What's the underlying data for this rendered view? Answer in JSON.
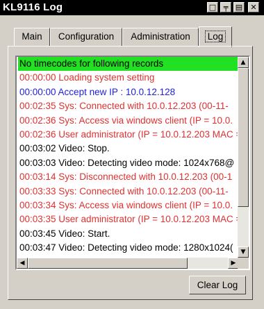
{
  "window": {
    "title": "KL9116 Log",
    "buttons": [
      {
        "name": "window-restore-button",
        "icon": "restore-icon",
        "glyph": "□"
      },
      {
        "name": "window-pin-button",
        "icon": "pin-icon",
        "glyph": "╤"
      },
      {
        "name": "window-export-button",
        "icon": "export-icon",
        "glyph": "▤"
      },
      {
        "name": "window-close-button",
        "icon": "close-icon",
        "glyph": "✕"
      }
    ]
  },
  "tabs": [
    {
      "label": "Main",
      "active": false
    },
    {
      "label": "Configuration",
      "active": false
    },
    {
      "label": "Administration",
      "active": false
    },
    {
      "label": "Log",
      "active": true
    }
  ],
  "log": {
    "header": "No timecodes for following records",
    "entries": [
      {
        "text": "00:00:00 Loading system setting",
        "color": "red"
      },
      {
        "text": "00:00:00 Accept new IP : 10.0.12.128",
        "color": "blue"
      },
      {
        "text": "00:02:35 Sys: Connected with 10.0.12.203 (00-11-",
        "color": "red"
      },
      {
        "text": "00:02:36 Sys: Access via windows client (IP = 10.0.",
        "color": "red"
      },
      {
        "text": "00:02:36 User administrator (IP = 10.0.12.203 MAC =",
        "color": "red"
      },
      {
        "text": "00:03:02 Video: Stop.",
        "color": "black"
      },
      {
        "text": "00:03:03 Video: Detecting video mode: 1024x768@",
        "color": "black"
      },
      {
        "text": "00:03:14 Sys: Disconnected with 10.0.12.203 (00-1",
        "color": "red"
      },
      {
        "text": "00:03:33 Sys: Connected with 10.0.12.203 (00-11-",
        "color": "red"
      },
      {
        "text": "00:03:34 Sys: Access via windows client (IP = 10.0.",
        "color": "red"
      },
      {
        "text": "00:03:35 User administrator (IP = 10.0.12.203 MAC =",
        "color": "red"
      },
      {
        "text": "00:03:45 Video: Start.",
        "color": "black"
      },
      {
        "text": "00:03:47 Video: Detecting video mode: 1280x1024(",
        "color": "black"
      }
    ]
  },
  "clear_button_label": "Clear Log",
  "colors": {
    "header_bg": "#22e022",
    "red": "#e03030",
    "blue": "#2020e0"
  }
}
